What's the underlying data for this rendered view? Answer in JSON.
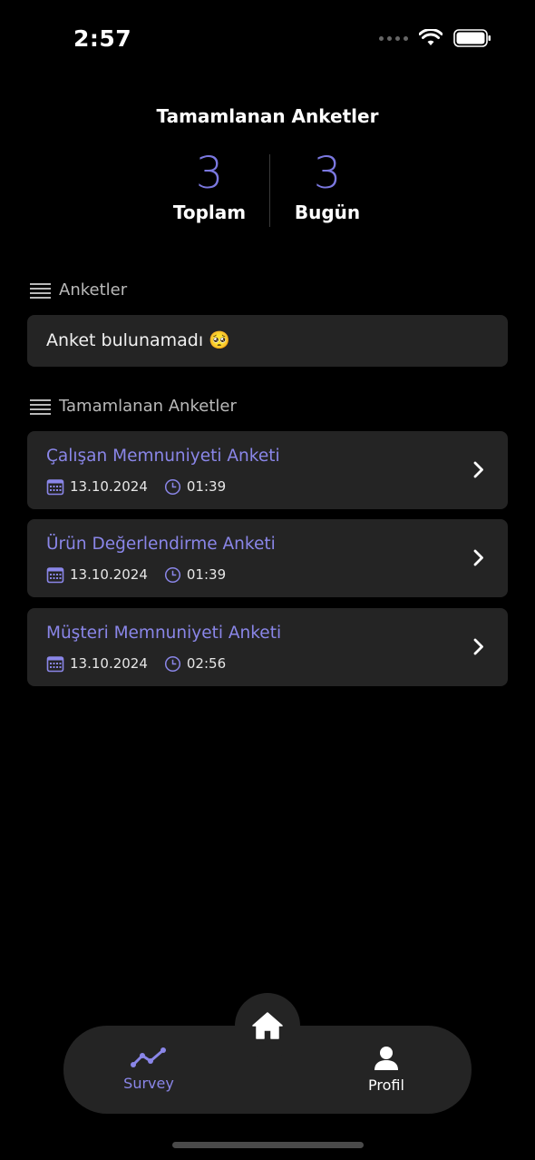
{
  "status_bar": {
    "time": "2:57"
  },
  "stats": {
    "title": "Tamamlanan Anketler",
    "total": {
      "value": "3",
      "label": "Toplam"
    },
    "today": {
      "value": "3",
      "label": "Bugün"
    }
  },
  "surveys_section": {
    "title": "Anketler",
    "empty_message": "Anket bulunamadı 🥺"
  },
  "completed_section": {
    "title": "Tamamlanan Anketler",
    "items": [
      {
        "title": "Çalışan Memnuniyeti Anketi",
        "date": "13.10.2024",
        "time": "01:39"
      },
      {
        "title": "Ürün Değerlendirme Anketi",
        "date": "13.10.2024",
        "time": "01:39"
      },
      {
        "title": "Müşteri Memnuniyeti Anketi",
        "date": "13.10.2024",
        "time": "02:56"
      }
    ]
  },
  "tabbar": {
    "survey_label": "Survey",
    "profil_label": "Profil"
  },
  "colors": {
    "accent": "#8a86e8",
    "card": "#242424",
    "background": "#000000"
  }
}
